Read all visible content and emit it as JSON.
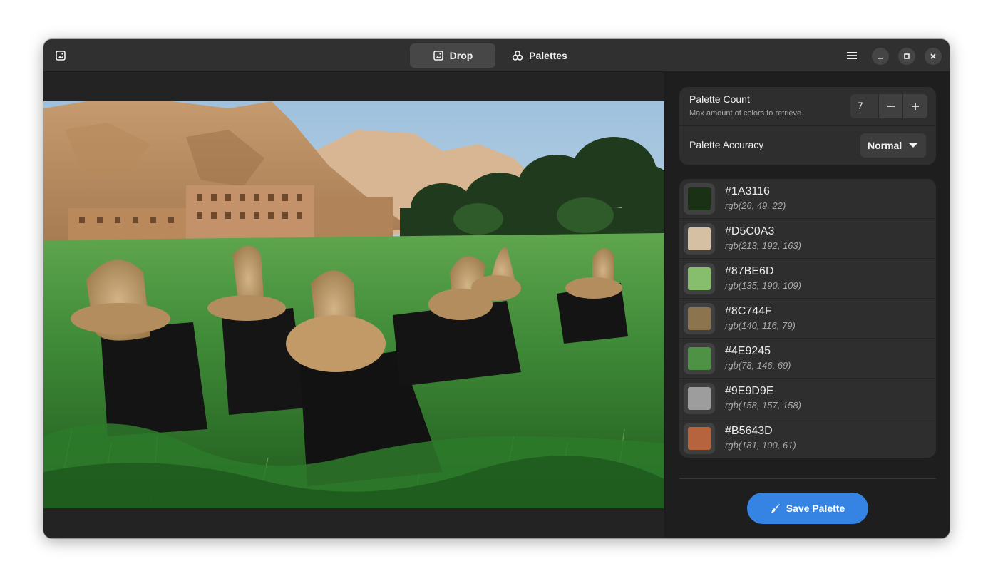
{
  "header": {
    "tabs": [
      {
        "label": "Drop",
        "icon": "image-icon",
        "active": true
      },
      {
        "label": "Palettes",
        "icon": "palette-icon",
        "active": false
      }
    ]
  },
  "settings": {
    "palette_count": {
      "title": "Palette Count",
      "subtitle": "Max amount of colors to retrieve.",
      "value": "7"
    },
    "palette_accuracy": {
      "title": "Palette Accuracy",
      "value": "Normal"
    }
  },
  "colors": [
    {
      "hex": "#1A3116",
      "rgb": "rgb(26, 49, 22)"
    },
    {
      "hex": "#D5C0A3",
      "rgb": "rgb(213, 192, 163)"
    },
    {
      "hex": "#87BE6D",
      "rgb": "rgb(135, 190, 109)"
    },
    {
      "hex": "#8C744F",
      "rgb": "rgb(140, 116, 79)"
    },
    {
      "hex": "#4E9245",
      "rgb": "rgb(78, 146, 69)"
    },
    {
      "hex": "#9E9D9E",
      "rgb": "rgb(158, 157, 158)"
    },
    {
      "hex": "#B5643D",
      "rgb": "rgb(181, 100, 61)"
    }
  ],
  "save_button": {
    "label": "Save Palette"
  },
  "theme": {
    "accent": "#3584e4",
    "window_bg": "#242424",
    "headerbar_bg": "#303030"
  }
}
